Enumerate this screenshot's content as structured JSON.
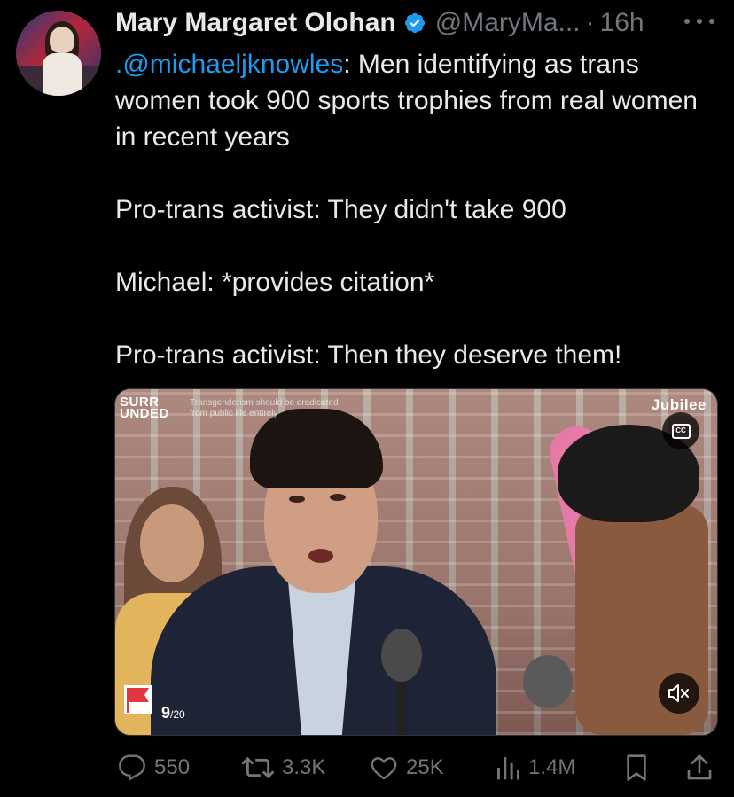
{
  "tweet": {
    "author_name": "Mary Margaret Olohan",
    "handle": "@MaryMa...",
    "separator": "·",
    "time": "16h",
    "text": {
      "line1_mention": ".@michaeljknowles",
      "line1_rest": ": Men identifying as trans women took 900 sports trophies from real women in recent years",
      "paragraph2": "Pro-trans activist: They didn't take 900",
      "paragraph3": "Michael: *provides citation*",
      "paragraph4": "Pro-trans activist: Then they deserve them!"
    }
  },
  "media": {
    "logo_line1": "SURR",
    "logo_line2": "UNDED",
    "caption_line1": "Transgenderism should be eradicated",
    "caption_line2": "from public life entirely",
    "brand": "Jubilee",
    "cc_label": "CC",
    "counter_current": "9",
    "counter_total": "/20"
  },
  "actions": {
    "replies": "550",
    "reposts": "3.3K",
    "likes": "25K",
    "views": "1.4M"
  },
  "colors": {
    "background": "#000000",
    "text": "#e7e9ea",
    "muted": "#71767b",
    "link": "#1d9bf0",
    "verified": "#1d9bf0"
  }
}
